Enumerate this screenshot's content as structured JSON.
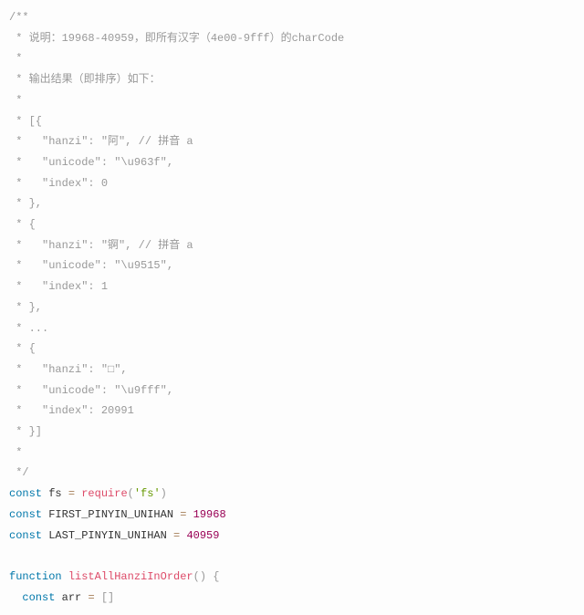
{
  "code": {
    "lines": [
      {
        "segments": [
          {
            "cls": "token-comment",
            "text": "/**"
          }
        ]
      },
      {
        "segments": [
          {
            "cls": "token-comment",
            "text": " * 说明：19968-40959，即所有汉字（4e00-9fff）的charCode"
          }
        ]
      },
      {
        "segments": [
          {
            "cls": "token-comment",
            "text": " *"
          }
        ]
      },
      {
        "segments": [
          {
            "cls": "token-comment",
            "text": " * 输出结果（即排序）如下："
          }
        ]
      },
      {
        "segments": [
          {
            "cls": "token-comment",
            "text": " *"
          }
        ]
      },
      {
        "segments": [
          {
            "cls": "token-comment",
            "text": " * [{"
          }
        ]
      },
      {
        "segments": [
          {
            "cls": "token-comment",
            "text": " *   \"hanzi\": \"阿\", // 拼音 a"
          }
        ]
      },
      {
        "segments": [
          {
            "cls": "token-comment",
            "text": " *   \"unicode\": \"\\u963f\","
          }
        ]
      },
      {
        "segments": [
          {
            "cls": "token-comment",
            "text": " *   \"index\": 0"
          }
        ]
      },
      {
        "segments": [
          {
            "cls": "token-comment",
            "text": " * },"
          }
        ]
      },
      {
        "segments": [
          {
            "cls": "token-comment",
            "text": " * {"
          }
        ]
      },
      {
        "segments": [
          {
            "cls": "token-comment",
            "text": " *   \"hanzi\": \"锕\", // 拼音 a"
          }
        ]
      },
      {
        "segments": [
          {
            "cls": "token-comment",
            "text": " *   \"unicode\": \"\\u9515\","
          }
        ]
      },
      {
        "segments": [
          {
            "cls": "token-comment",
            "text": " *   \"index\": 1"
          }
        ]
      },
      {
        "segments": [
          {
            "cls": "token-comment",
            "text": " * },"
          }
        ]
      },
      {
        "segments": [
          {
            "cls": "token-comment",
            "text": " * ..."
          }
        ]
      },
      {
        "segments": [
          {
            "cls": "token-comment",
            "text": " * {"
          }
        ]
      },
      {
        "segments": [
          {
            "cls": "token-comment",
            "text": " *   \"hanzi\": \"□\","
          }
        ]
      },
      {
        "segments": [
          {
            "cls": "token-comment",
            "text": " *   \"unicode\": \"\\u9fff\","
          }
        ]
      },
      {
        "segments": [
          {
            "cls": "token-comment",
            "text": " *   \"index\": 20991"
          }
        ]
      },
      {
        "segments": [
          {
            "cls": "token-comment",
            "text": " * }]"
          }
        ]
      },
      {
        "segments": [
          {
            "cls": "token-comment",
            "text": " *"
          }
        ]
      },
      {
        "segments": [
          {
            "cls": "token-comment",
            "text": " */"
          }
        ]
      },
      {
        "segments": [
          {
            "cls": "token-keyword",
            "text": "const"
          },
          {
            "cls": "token-plain",
            "text": " fs "
          },
          {
            "cls": "token-operator",
            "text": "="
          },
          {
            "cls": "token-plain",
            "text": " "
          },
          {
            "cls": "token-function",
            "text": "require"
          },
          {
            "cls": "token-punct",
            "text": "("
          },
          {
            "cls": "token-string",
            "text": "'fs'"
          },
          {
            "cls": "token-punct",
            "text": ")"
          }
        ]
      },
      {
        "segments": [
          {
            "cls": "token-keyword",
            "text": "const"
          },
          {
            "cls": "token-plain",
            "text": " FIRST_PINYIN_UNIHAN "
          },
          {
            "cls": "token-operator",
            "text": "="
          },
          {
            "cls": "token-plain",
            "text": " "
          },
          {
            "cls": "token-number",
            "text": "19968"
          }
        ]
      },
      {
        "segments": [
          {
            "cls": "token-keyword",
            "text": "const"
          },
          {
            "cls": "token-plain",
            "text": " LAST_PINYIN_UNIHAN "
          },
          {
            "cls": "token-operator",
            "text": "="
          },
          {
            "cls": "token-plain",
            "text": " "
          },
          {
            "cls": "token-number",
            "text": "40959"
          }
        ]
      },
      {
        "segments": [
          {
            "cls": "token-plain",
            "text": ""
          }
        ]
      },
      {
        "segments": [
          {
            "cls": "token-keyword",
            "text": "function"
          },
          {
            "cls": "token-plain",
            "text": " "
          },
          {
            "cls": "token-function",
            "text": "listAllHanziInOrder"
          },
          {
            "cls": "token-punct",
            "text": "("
          },
          {
            "cls": "token-punct",
            "text": ")"
          },
          {
            "cls": "token-plain",
            "text": " "
          },
          {
            "cls": "token-punct",
            "text": "{"
          }
        ]
      },
      {
        "segments": [
          {
            "cls": "token-plain",
            "text": "  "
          },
          {
            "cls": "token-keyword",
            "text": "const"
          },
          {
            "cls": "token-plain",
            "text": " arr "
          },
          {
            "cls": "token-operator",
            "text": "="
          },
          {
            "cls": "token-plain",
            "text": " "
          },
          {
            "cls": "token-punct",
            "text": "["
          },
          {
            "cls": "token-punct",
            "text": "]"
          }
        ]
      }
    ]
  }
}
